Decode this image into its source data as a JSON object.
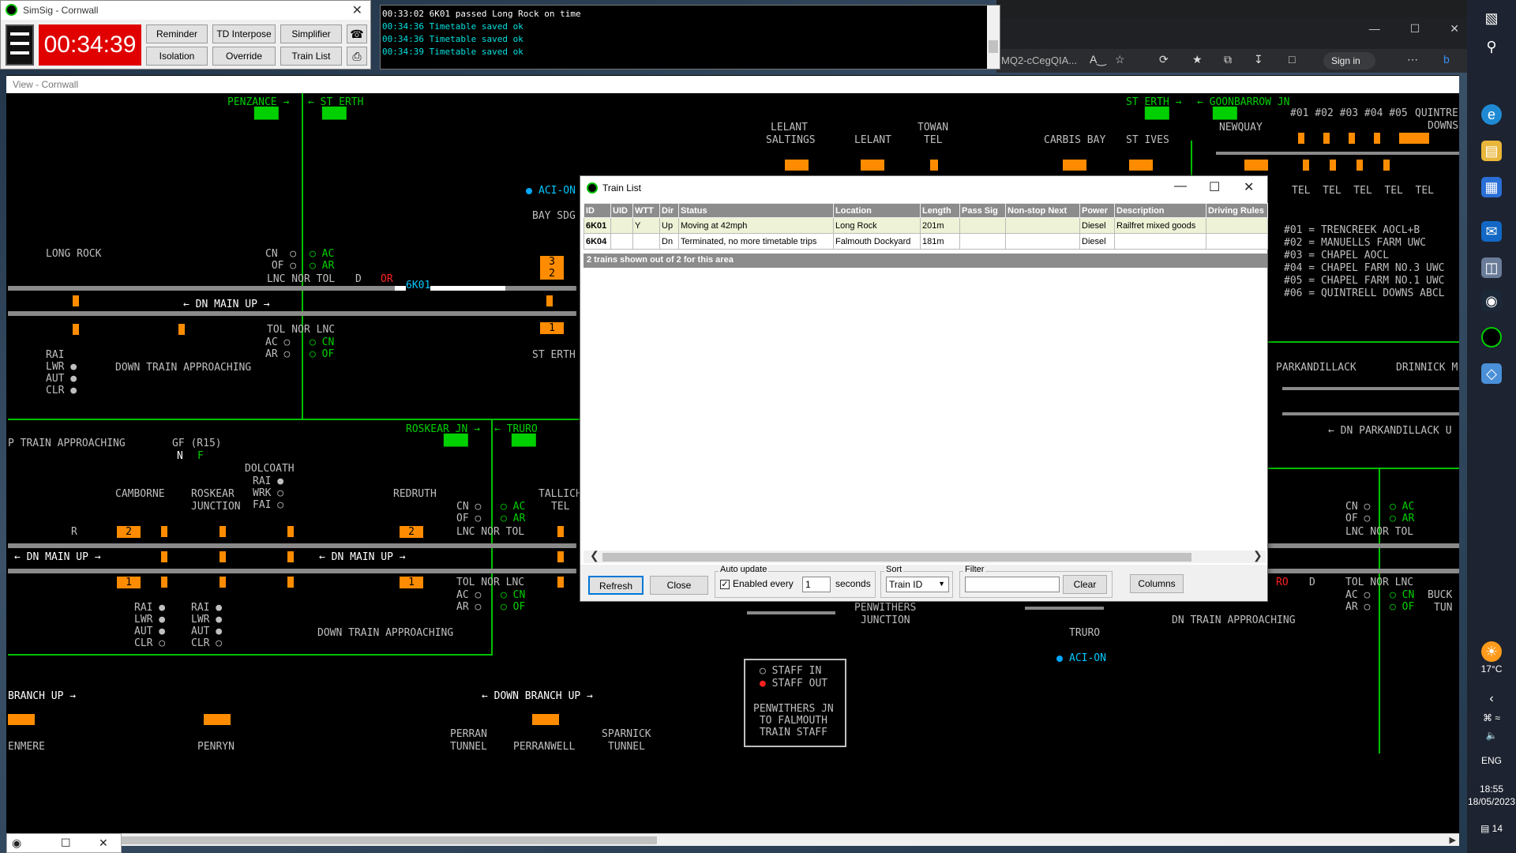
{
  "control": {
    "title": "SimSig - Cornwall",
    "clock": "00:34:39",
    "buttons": [
      "Reminder",
      "TD Interpose",
      "Simplifier",
      "Isolation",
      "Override",
      "Train List"
    ]
  },
  "log": {
    "lines": [
      "00:33:02 6K01 passed Long Rock on time",
      "00:34:36 Timetable saved ok",
      "00:34:36 Timetable saved ok",
      "00:34:39 Timetable saved ok"
    ]
  },
  "browser": {
    "url": "MQ2-cCegQIA...",
    "sign_in": "Sign in"
  },
  "view": {
    "title": "View - Cornwall"
  },
  "diagram": {
    "labels": {
      "penzance": "PENZANCE →",
      "st_erth_arrow": "← ST ERTH",
      "st_erth_top_right": "ST ERTH →",
      "goonbarrow": "← GOONBARROW JN",
      "lelant_saltings_1": "LELANT",
      "lelant_saltings_2": "SALTINGS",
      "lelant": "LELANT",
      "towan_1": "TOWAN",
      "towan_2": "TEL",
      "carbis_bay": "CARBIS BAY",
      "st_ives": "ST IVES",
      "newquay": "NEWQUAY",
      "hash_row": "#01 #02 #03 #04 #05",
      "quintrell_1": "QUINTRE",
      "quintrell_2": "DOWNS",
      "tel_row": "TEL  TEL  TEL  TEL  TEL",
      "legend_1": "#01 = TRENCREEK AOCL+B",
      "legend_2": "#02 = MANUELLS FARM UWC",
      "legend_3": "#03 = CHAPEL AOCL",
      "legend_4": "#04 = CHAPEL FARM NO.3 UWC",
      "legend_5": "#05 = CHAPEL FARM NO.1 UWC",
      "legend_6": "#06 = QUINTRELL DOWNS ABCL",
      "aci_on_1": "ACI-ON",
      "bay_sdg": "BAY SDG",
      "long_rock": "LONG ROCK",
      "cn_of_1": "CN  ○\n OF ○",
      "ac_ar_1": "○ AC\n○ AR",
      "lnc_nor_tol_1": "LNC NOR TOL",
      "dn_main_up_1": "← DN MAIN UP →",
      "tol_nor_lnc_1": "TOL NOR LNC",
      "ac_ar_2": "AC ○\nAR ○",
      "cn_of_2": "○ CN\n○ OF",
      "train_id": "6K01",
      "d_or": "D",
      "or": "OR",
      "st_erth_low": "ST ERTH",
      "rai_lwr": "RAI\nLWR ●\nAUT ●\nCLR ●",
      "down_train_approaching_1": "DOWN TRAIN APPROACHING",
      "p_train_approaching": "P TRAIN APPROACHING",
      "gf_r15": "GF (R15)",
      "n": "N",
      "f": "F",
      "dolcoath": "DOLCOATH",
      "camborne": "CAMBORNE",
      "roskear_junction_1": "ROSKEAR",
      "roskear_junction_2": "JUNCTION",
      "rai_wrk_fai": "RAI ●\nWRK ○\nFAI ○",
      "redruth": "REDRUTH",
      "roskear_jn": "ROSKEAR JN →",
      "truro_arrow": "← TRURO",
      "tallich": "TALLICH",
      "tel": "TEL",
      "dn_main_up_2": "← DN MAIN UP →",
      "dn_main_up_3": "← DN MAIN UP →",
      "cn_of_3": "CN ○\nOF ○",
      "ac_ar_3": "○ AC\n○ AR",
      "lnc_nor_tol_2": "LNC NOR TOL",
      "tol_nor_lnc_2": "TOL NOR LNC",
      "ac_ar_4": "AC ○\nAR ○",
      "cn_of_4": "○ CN\n○ OF",
      "rai_block_1": "RAI ●\nLWR ●\nAUT ●\nCLR ○",
      "rai_block_2": "RAI ●\nLWR ●\nAUT ●\nCLR ○",
      "down_train_approaching_2": "DOWN TRAIN APPROACHING",
      "branch_up": "BRANCH UP →",
      "down_branch_up": "← DOWN BRANCH UP →",
      "enmere": "ENMERE",
      "penryn": "PENRYN",
      "perran_tunnel_1": "PERRAN",
      "perran_tunnel_2": "TUNNEL",
      "perranwell": "PERRANWELL",
      "sparnick_1": "SPARNICK",
      "sparnick_2": "TUNNEL",
      "penwithers_1": "PENWITHERS",
      "penwithers_2": "JUNCTION",
      "truro": "TRURO",
      "aci_on_2": "ACI-ON",
      "staff_in": "STAFF IN",
      "staff_out": "STAFF OUT",
      "staff_note": "PENWITHERS JN\n TO FALMOUTH\n TRAIN STAFF",
      "parkandillack": "PARKANDILLACK",
      "drinnick": "DRINNICK M",
      "dn_parkandillack": "← DN PARKANDILLACK U",
      "cn_of_5": "CN ○\nOF ○",
      "ac_ar_5": "○ AC\n○ AR",
      "lnc_nor_tol_3": "LNC NOR TOL",
      "tol_nor_lnc_3": "TOL NOR LNC",
      "ac_ar_6": "AC ○\nAR ○",
      "cn_of_6": "○ CN\n○ OF",
      "down_train_approaching_3": "DN TRAIN APPROACHING",
      "buck": "BUCK",
      "tun": "TUN",
      "ro": "RO",
      "d": "D",
      "r": "R"
    },
    "berths": {
      "b3": "3",
      "b2": "2",
      "b1": "1",
      "b2b": "2",
      "b1b": "1",
      "b1c": "1",
      "b2c": "2"
    }
  },
  "train_list": {
    "title": "Train List",
    "columns": [
      "ID",
      "UID",
      "WTT",
      "Dir",
      "Status",
      "Location",
      "Length",
      "Pass Sig",
      "Non-stop Next",
      "Power",
      "Description",
      "Driving Rules"
    ],
    "rows": [
      {
        "id": "6K01",
        "uid": "",
        "wtt": "Y",
        "dir": "Up",
        "status": "Moving at 42mph",
        "location": "Long Rock",
        "length": "201m",
        "pass_sig": "",
        "non_stop": "",
        "power": "Diesel",
        "description": "Railfret mixed goods",
        "driving_rules": ""
      },
      {
        "id": "6K04",
        "uid": "",
        "wtt": "",
        "dir": "Dn",
        "status": "Terminated, no more timetable trips",
        "location": "Falmouth Dockyard",
        "length": "181m",
        "pass_sig": "",
        "non_stop": "",
        "power": "Diesel",
        "description": "",
        "driving_rules": ""
      }
    ],
    "summary": "2 trains shown out of 2 for this area",
    "refresh": "Refresh",
    "close": "Close",
    "auto_update_label": "Auto update",
    "enabled_every": "Enabled every",
    "interval": "1",
    "seconds": "seconds",
    "sort_label": "Sort",
    "sort_value": "Train ID",
    "filter_label": "Filter",
    "filter_value": "",
    "clear": "Clear",
    "columns_button": "Columns"
  },
  "taskbar": {
    "temp": "17°C",
    "lang": "ENG",
    "time": "18:55",
    "date": "18/05/2023",
    "notif": "14"
  },
  "colors": {
    "clock_bg": "#e00000",
    "track": "#8a8a8a",
    "berth": "#ff8c00",
    "label_green": "#00d000",
    "aci_blue": "#00c8ff"
  }
}
